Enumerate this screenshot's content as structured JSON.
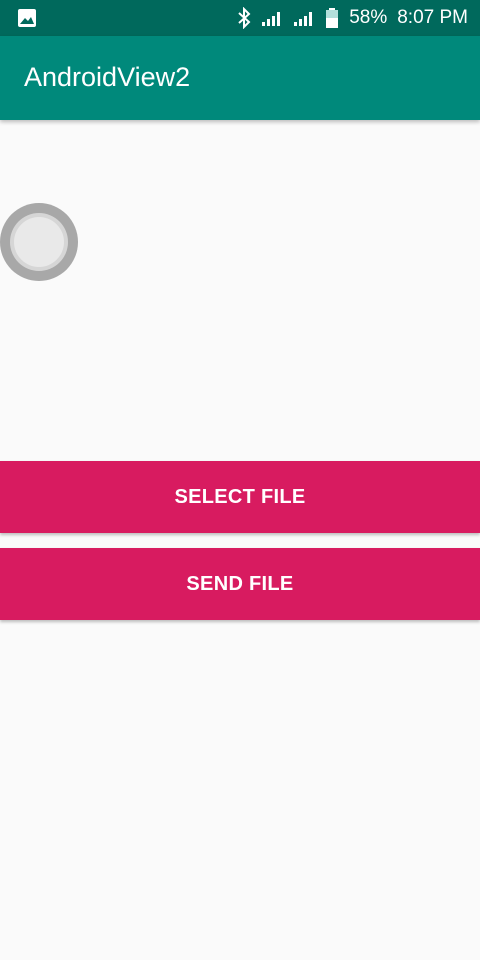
{
  "status_bar": {
    "battery": "58%",
    "time": "8:07 PM",
    "icons": [
      "image-icon",
      "bluetooth-icon",
      "signal-icon",
      "signal-icon",
      "battery-icon"
    ]
  },
  "app_bar": {
    "title": "AndroidView2"
  },
  "buttons": {
    "select_file": "SELECT FILE",
    "send_file": "SEND FILE"
  },
  "colors": {
    "status_bar": "#00695c",
    "app_bar": "#00897b",
    "accent": "#d81b60",
    "background": "#fafafa"
  }
}
